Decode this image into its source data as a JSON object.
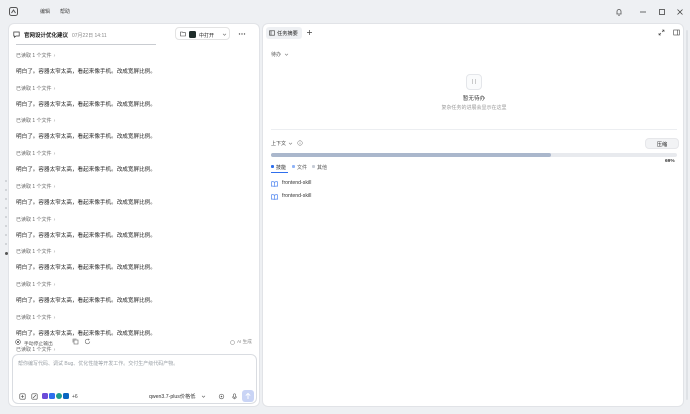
{
  "titlebar": {
    "menu": [
      "编辑",
      "帮助"
    ],
    "accent": "#2f6fed"
  },
  "chat": {
    "title": "官网设计优化建议",
    "date": "07月22日 14:11",
    "open_label": "中打开",
    "truncated_line": "…",
    "messages": [
      {
        "read": "已读取 1 个文件",
        "text": "明白了。容器太窄太高，看起来像手机。改成宽屏比例。"
      },
      {
        "read": "已读取 1 个文件",
        "text": "明白了。容器太窄太高，看起来像手机。改成宽屏比例。"
      },
      {
        "read": "已读取 1 个文件",
        "text": "明白了。容器太窄太高，看起来像手机。改成宽屏比例。"
      },
      {
        "read": "已读取 1 个文件",
        "text": "明白了。容器太窄太高，看起来像手机。改成宽屏比例。"
      },
      {
        "read": "已读取 1 个文件",
        "text": "明白了。容器太窄太高，看起来像手机。改成宽屏比例。"
      },
      {
        "read": "已读取 1 个文件",
        "text": "明白了。容器太窄太高，看起来像手机。改成宽屏比例。"
      },
      {
        "read": "已读取 1 个文件",
        "text": "明白了。容器太窄太高，看起来像手机。改成宽屏比例。"
      },
      {
        "read": "已读取 1 个文件",
        "text": "明白了。容器太窄太高，看起来像手机。改成宽屏比例。"
      },
      {
        "read": "已读取 1 个文件",
        "text": "明白了。容器太窄太高，看起来像手机。改成宽屏比例。"
      }
    ],
    "last_read": "已读取 1 个文件",
    "stop_label": "手动停止输出",
    "ai_label": "AI 生成",
    "input_placeholder": "帮你编写代码、调试 Bug、优化性能等开发工作。交付生产级代码产物。",
    "plus_count": "+6",
    "model": "qwen3.7-plus价格低"
  },
  "panel": {
    "tab": "任务摘要",
    "pending": "待办",
    "empty_title": "暂无待办",
    "empty_desc": "复杂任务的进展会显示在这里",
    "context_label": "上下文",
    "compress": "压缩",
    "progress_pct": "69%",
    "progress_value": 0.69,
    "tabs": [
      "技能",
      "文件",
      "其他"
    ],
    "skills": [
      "frontend-skill",
      "frontend-skill"
    ]
  }
}
